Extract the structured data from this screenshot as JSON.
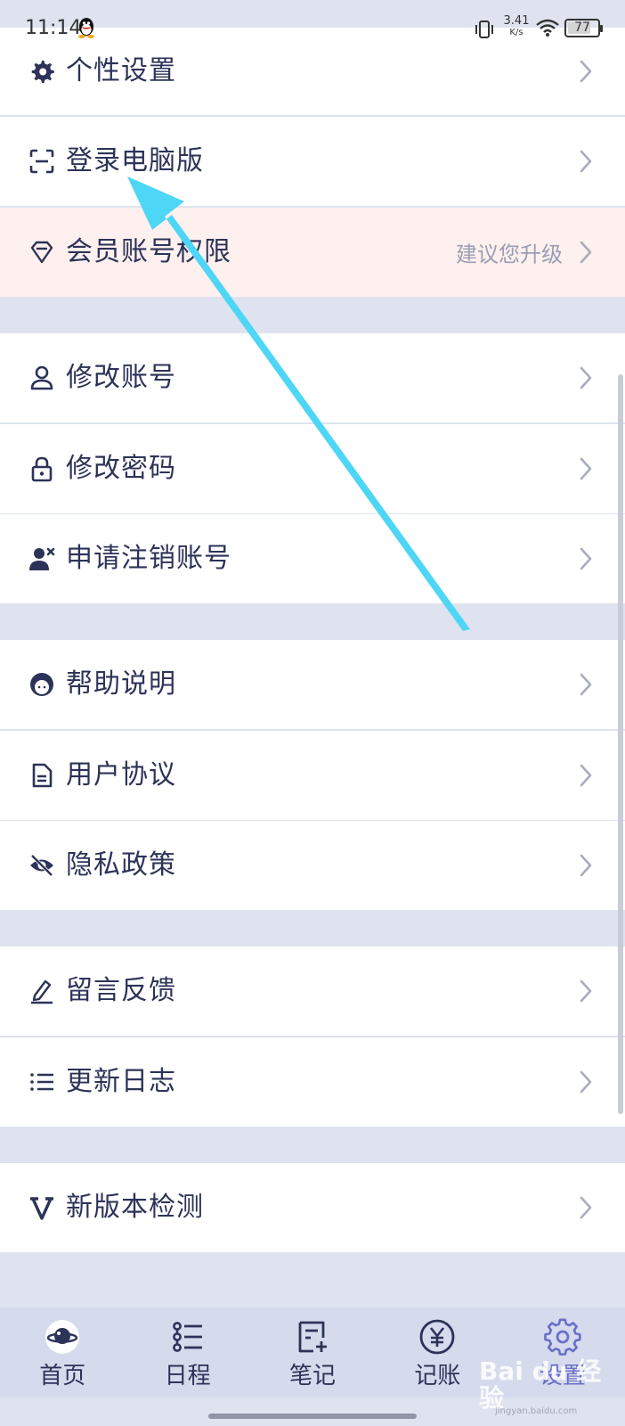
{
  "status_bar": {
    "time": "11:14",
    "net_speed_value": "3.41",
    "net_speed_unit": "K/s",
    "battery": "77",
    "battery_level": 0.77
  },
  "menu": {
    "personal_settings": "个性设置",
    "pc_login": "登录电脑版",
    "member_limit": "会员账号权限",
    "upgrade_hint": "建议您升级",
    "change_account": "修改账号",
    "change_password": "修改密码",
    "cancel_account": "申请注销账号",
    "help": "帮助说明",
    "user_agreement": "用户协议",
    "privacy_policy": "隐私政策",
    "feedback": "留言反馈",
    "changelog": "更新日志",
    "version_check": "新版本检测"
  },
  "tabs": [
    {
      "label": "首页",
      "icon": "planet-icon"
    },
    {
      "label": "日程",
      "icon": "schedule-icon"
    },
    {
      "label": "笔记",
      "icon": "note-icon"
    },
    {
      "label": "记账",
      "icon": "yen-icon"
    },
    {
      "label": "设置",
      "icon": "gear-icon"
    }
  ],
  "active_tab": "设置",
  "watermark": {
    "brand": "Bai du 经验",
    "url": "jingyan.baidu.com"
  },
  "colors": {
    "background": "#dfe3ef",
    "text": "#2d3358",
    "highlight_row": "#fdf0ee",
    "tabbar": "#d5dbec",
    "active_tab": "#6b6fc7",
    "annotation_arrow": "#4dd6f5"
  }
}
